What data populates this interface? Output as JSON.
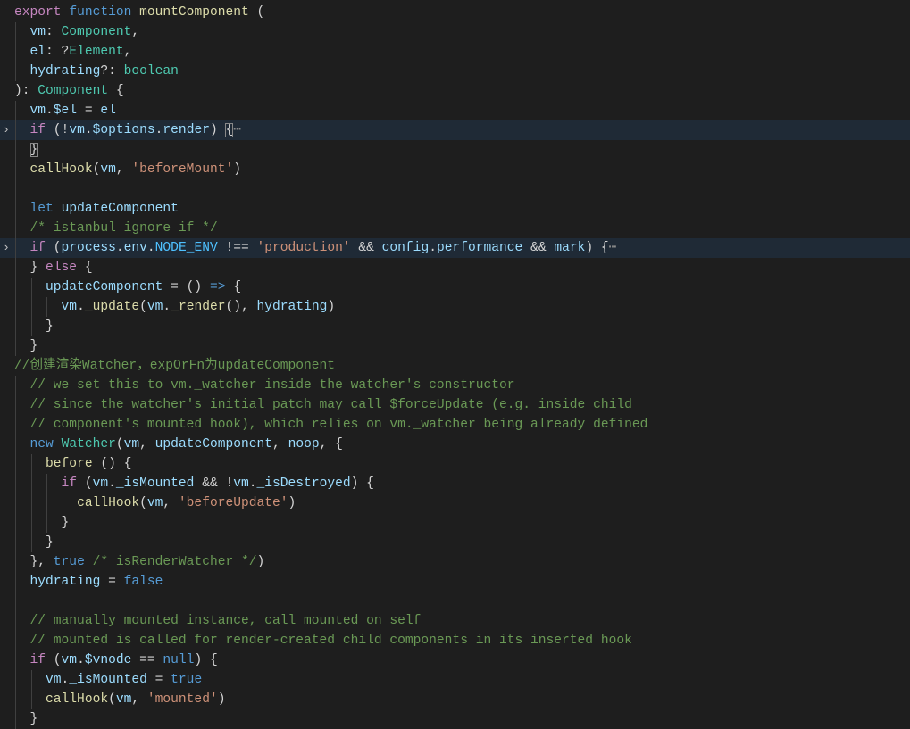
{
  "editor": {
    "colors": {
      "background": "#1e1e1e",
      "keyword": "#c586c0",
      "storage": "#569cd6",
      "variable": "#9cdcfe",
      "type": "#4ec9b0",
      "function": "#dcdcaa",
      "string": "#ce9178",
      "comment": "#6a9955",
      "constant": "#4fc1ff"
    },
    "fold_icon": "chevron-right-icon",
    "lines": [
      {
        "i": 0,
        "t": [
          [
            "k",
            "export"
          ],
          [
            "p",
            " "
          ],
          [
            "s",
            "function"
          ],
          [
            "p",
            " "
          ],
          [
            "f",
            "mountComponent"
          ],
          [
            "p",
            " ("
          ]
        ]
      },
      {
        "i": 1,
        "t": [
          [
            "v",
            "vm"
          ],
          [
            "p",
            ": "
          ],
          [
            "t",
            "Component"
          ],
          [
            "p",
            ","
          ]
        ]
      },
      {
        "i": 1,
        "t": [
          [
            "v",
            "el"
          ],
          [
            "p",
            ": ?"
          ],
          [
            "t",
            "Element"
          ],
          [
            "p",
            ","
          ]
        ]
      },
      {
        "i": 1,
        "t": [
          [
            "v",
            "hydrating"
          ],
          [
            "p",
            "?: "
          ],
          [
            "t",
            "boolean"
          ]
        ]
      },
      {
        "i": 0,
        "t": [
          [
            "p",
            "): "
          ],
          [
            "t",
            "Component"
          ],
          [
            "p",
            " {"
          ]
        ]
      },
      {
        "i": 1,
        "t": [
          [
            "v",
            "vm"
          ],
          [
            "p",
            "."
          ],
          [
            "v",
            "$el"
          ],
          [
            "p",
            " = "
          ],
          [
            "v",
            "el"
          ]
        ]
      },
      {
        "i": 1,
        "hl": true,
        "fold": true,
        "t": [
          [
            "k",
            "if"
          ],
          [
            "p",
            " (!"
          ],
          [
            "v",
            "vm"
          ],
          [
            "p",
            "."
          ],
          [
            "v",
            "$options"
          ],
          [
            "p",
            "."
          ],
          [
            "v",
            "render"
          ],
          [
            "p",
            ") "
          ],
          [
            "b",
            "{"
          ],
          [
            "e",
            "⋯"
          ]
        ]
      },
      {
        "i": 1,
        "t": [
          [
            "b",
            "}"
          ]
        ]
      },
      {
        "i": 1,
        "t": [
          [
            "f",
            "callHook"
          ],
          [
            "p",
            "("
          ],
          [
            "v",
            "vm"
          ],
          [
            "p",
            ", "
          ],
          [
            "str",
            "'beforeMount'"
          ],
          [
            "p",
            ")"
          ]
        ]
      },
      {
        "i": 1,
        "t": []
      },
      {
        "i": 1,
        "t": [
          [
            "s",
            "let"
          ],
          [
            "p",
            " "
          ],
          [
            "v",
            "updateComponent"
          ]
        ]
      },
      {
        "i": 1,
        "t": [
          [
            "c",
            "/* istanbul ignore if */"
          ]
        ]
      },
      {
        "i": 1,
        "hl": true,
        "fold": true,
        "t": [
          [
            "k",
            "if"
          ],
          [
            "p",
            " ("
          ],
          [
            "v",
            "process"
          ],
          [
            "p",
            "."
          ],
          [
            "v",
            "env"
          ],
          [
            "p",
            "."
          ],
          [
            "n",
            "NODE_ENV"
          ],
          [
            "p",
            " !== "
          ],
          [
            "str",
            "'production'"
          ],
          [
            "p",
            " && "
          ],
          [
            "v",
            "config"
          ],
          [
            "p",
            "."
          ],
          [
            "v",
            "performance"
          ],
          [
            "p",
            " && "
          ],
          [
            "v",
            "mark"
          ],
          [
            "p",
            ") {"
          ],
          [
            "e",
            "⋯"
          ]
        ]
      },
      {
        "i": 1,
        "t": [
          [
            "p",
            "} "
          ],
          [
            "k",
            "else"
          ],
          [
            "p",
            " {"
          ]
        ]
      },
      {
        "i": 2,
        "t": [
          [
            "v",
            "updateComponent"
          ],
          [
            "p",
            " = () "
          ],
          [
            "s",
            "=>"
          ],
          [
            "p",
            " {"
          ]
        ]
      },
      {
        "i": 3,
        "t": [
          [
            "v",
            "vm"
          ],
          [
            "p",
            "."
          ],
          [
            "f",
            "_update"
          ],
          [
            "p",
            "("
          ],
          [
            "v",
            "vm"
          ],
          [
            "p",
            "."
          ],
          [
            "f",
            "_render"
          ],
          [
            "p",
            "(), "
          ],
          [
            "v",
            "hydrating"
          ],
          [
            "p",
            ")"
          ]
        ]
      },
      {
        "i": 2,
        "t": [
          [
            "p",
            "}"
          ]
        ]
      },
      {
        "i": 1,
        "t": [
          [
            "p",
            "}"
          ]
        ]
      },
      {
        "i": 0,
        "t": [
          [
            "c",
            "//创建渲染Watcher，expOrFn为updateComponent"
          ]
        ]
      },
      {
        "i": 1,
        "t": [
          [
            "c",
            "// we set this to vm._watcher inside the watcher's constructor"
          ]
        ]
      },
      {
        "i": 1,
        "t": [
          [
            "c",
            "// since the watcher's initial patch may call $forceUpdate (e.g. inside child"
          ]
        ]
      },
      {
        "i": 1,
        "t": [
          [
            "c",
            "// component's mounted hook), which relies on vm._watcher being already defined"
          ]
        ]
      },
      {
        "i": 1,
        "t": [
          [
            "s",
            "new"
          ],
          [
            "p",
            " "
          ],
          [
            "t",
            "Watcher"
          ],
          [
            "p",
            "("
          ],
          [
            "v",
            "vm"
          ],
          [
            "p",
            ", "
          ],
          [
            "v",
            "updateComponent"
          ],
          [
            "p",
            ", "
          ],
          [
            "v",
            "noop"
          ],
          [
            "p",
            ", {"
          ]
        ]
      },
      {
        "i": 2,
        "t": [
          [
            "f",
            "before"
          ],
          [
            "p",
            " () {"
          ]
        ]
      },
      {
        "i": 3,
        "t": [
          [
            "k",
            "if"
          ],
          [
            "p",
            " ("
          ],
          [
            "v",
            "vm"
          ],
          [
            "p",
            "."
          ],
          [
            "v",
            "_isMounted"
          ],
          [
            "p",
            " && !"
          ],
          [
            "v",
            "vm"
          ],
          [
            "p",
            "."
          ],
          [
            "v",
            "_isDestroyed"
          ],
          [
            "p",
            ") {"
          ]
        ]
      },
      {
        "i": 4,
        "t": [
          [
            "f",
            "callHook"
          ],
          [
            "p",
            "("
          ],
          [
            "v",
            "vm"
          ],
          [
            "p",
            ", "
          ],
          [
            "str",
            "'beforeUpdate'"
          ],
          [
            "p",
            ")"
          ]
        ]
      },
      {
        "i": 3,
        "t": [
          [
            "p",
            "}"
          ]
        ]
      },
      {
        "i": 2,
        "t": [
          [
            "p",
            "}"
          ]
        ]
      },
      {
        "i": 1,
        "t": [
          [
            "p",
            "}, "
          ],
          [
            "s",
            "true"
          ],
          [
            "p",
            " "
          ],
          [
            "c",
            "/* isRenderWatcher */"
          ],
          [
            "p",
            ")"
          ]
        ]
      },
      {
        "i": 1,
        "t": [
          [
            "v",
            "hydrating"
          ],
          [
            "p",
            " = "
          ],
          [
            "s",
            "false"
          ]
        ]
      },
      {
        "i": 1,
        "t": []
      },
      {
        "i": 1,
        "t": [
          [
            "c",
            "// manually mounted instance, call mounted on self"
          ]
        ]
      },
      {
        "i": 1,
        "t": [
          [
            "c",
            "// mounted is called for render-created child components in its inserted hook"
          ]
        ]
      },
      {
        "i": 1,
        "t": [
          [
            "k",
            "if"
          ],
          [
            "p",
            " ("
          ],
          [
            "v",
            "vm"
          ],
          [
            "p",
            "."
          ],
          [
            "v",
            "$vnode"
          ],
          [
            "p",
            " == "
          ],
          [
            "s",
            "null"
          ],
          [
            "p",
            ") {"
          ]
        ]
      },
      {
        "i": 2,
        "t": [
          [
            "v",
            "vm"
          ],
          [
            "p",
            "."
          ],
          [
            "v",
            "_isMounted"
          ],
          [
            "p",
            " = "
          ],
          [
            "s",
            "true"
          ]
        ]
      },
      {
        "i": 2,
        "t": [
          [
            "f",
            "callHook"
          ],
          [
            "p",
            "("
          ],
          [
            "v",
            "vm"
          ],
          [
            "p",
            ", "
          ],
          [
            "str",
            "'mounted'"
          ],
          [
            "p",
            ")"
          ]
        ]
      },
      {
        "i": 1,
        "t": [
          [
            "p",
            "}"
          ]
        ]
      }
    ]
  }
}
